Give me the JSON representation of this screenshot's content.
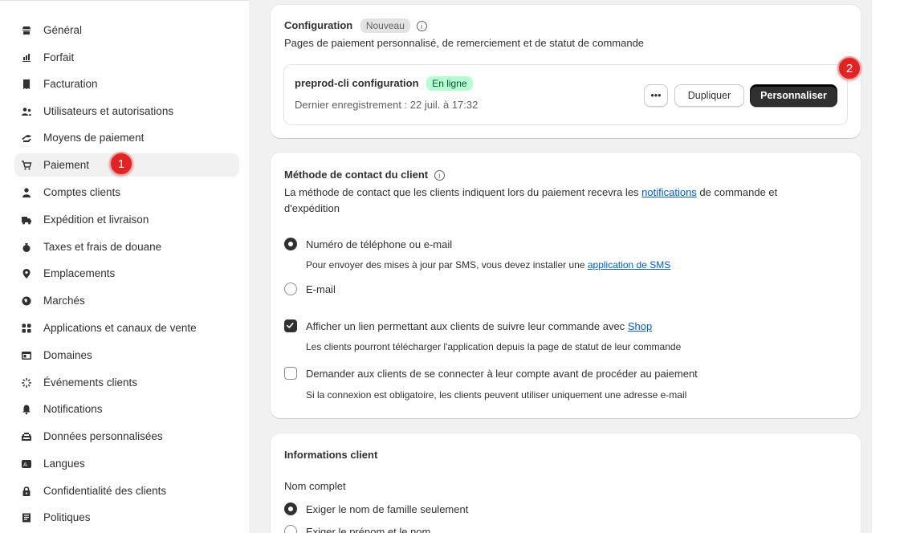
{
  "sidebar": {
    "items": [
      {
        "label": "Général",
        "icon": "store-icon"
      },
      {
        "label": "Forfait",
        "icon": "plan-icon"
      },
      {
        "label": "Facturation",
        "icon": "receipt-icon"
      },
      {
        "label": "Utilisateurs et autorisations",
        "icon": "users-icon"
      },
      {
        "label": "Moyens de paiement",
        "icon": "payment-icon"
      },
      {
        "label": "Paiement",
        "icon": "cart-icon"
      },
      {
        "label": "Comptes clients",
        "icon": "person-icon"
      },
      {
        "label": "Expédition et livraison",
        "icon": "truck-icon"
      },
      {
        "label": "Taxes et frais de douane",
        "icon": "tax-icon"
      },
      {
        "label": "Emplacements",
        "icon": "location-icon"
      },
      {
        "label": "Marchés",
        "icon": "globe-icon"
      },
      {
        "label": "Applications et canaux de vente",
        "icon": "apps-icon"
      },
      {
        "label": "Domaines",
        "icon": "domain-icon"
      },
      {
        "label": "Événements clients",
        "icon": "events-icon"
      },
      {
        "label": "Notifications",
        "icon": "bell-icon"
      },
      {
        "label": "Données personnalisées",
        "icon": "data-icon"
      },
      {
        "label": "Langues",
        "icon": "language-icon"
      },
      {
        "label": "Confidentialité des clients",
        "icon": "lock-icon"
      },
      {
        "label": "Politiques",
        "icon": "policy-icon"
      }
    ],
    "active_index": 5,
    "annotation": "1"
  },
  "config": {
    "title": "Configuration",
    "badge": "Nouveau",
    "description": "Pages de paiement personnalisé, de remerciement et de statut de commande",
    "item_name": "preprod-cli configuration",
    "status": "En ligne",
    "last_saved": "Dernier enregistrement : 22 juil. à 17:32",
    "more_label": "•••",
    "duplicate_label": "Dupliquer",
    "customize_label": "Personnaliser",
    "annotation": "2"
  },
  "contact": {
    "title": "Méthode de contact du client",
    "desc_before": "La méthode de contact que les clients indiquent lors du paiement recevra les ",
    "desc_link": "notifications",
    "desc_after": " de commande et",
    "desc_line2": "d'expédition",
    "option1_label": "Numéro de téléphone ou e-mail",
    "option1_help_before": "Pour envoyer des mises à jour par SMS, vous devez installer une ",
    "option1_help_link": "application de SMS",
    "option2_label": "E-mail",
    "check1_label_before": "Afficher un lien permettant aux clients de suivre leur commande avec ",
    "check1_label_link": "Shop",
    "check1_help": "Les clients pourront télécharger l'application depuis la page de statut de leur commande",
    "check2_label": "Demander aux clients de se connecter à leur compte avant de procéder au paiement",
    "check2_help": "Si la connexion est obligatoire, les clients peuvent utiliser uniquement une adresse e-mail"
  },
  "client_info": {
    "title": "Informations client",
    "fullname_label": "Nom complet",
    "option1_label": "Exiger le nom de famille seulement",
    "option2_label": "Exiger le prénom et le nom"
  },
  "colors": {
    "accent_link": "#005bd3",
    "status_green_bg": "#b4fed2",
    "annotation_red": "#e02424"
  }
}
